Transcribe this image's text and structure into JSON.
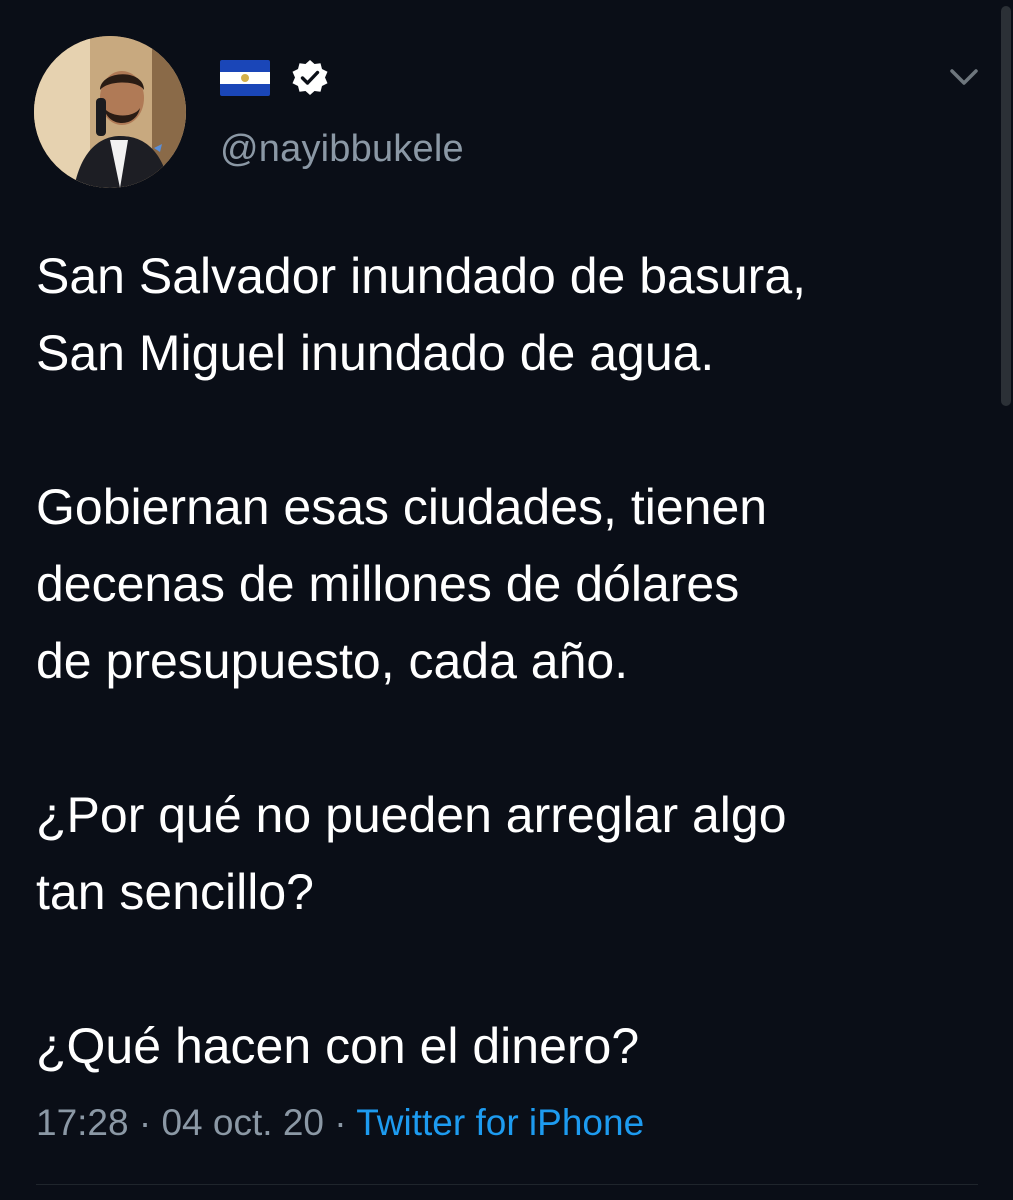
{
  "tweet": {
    "handle": "@nayibbukele",
    "paragraphs": [
      "San Salvador inundado de basura,\nSan Miguel inundado de agua.",
      "Gobiernan esas ciudades, tienen\ndecenas de millones de dólares\nde presupuesto, cada año.",
      "¿Por qué no pueden arreglar algo\ntan sencillo?",
      "¿Qué hacen con el dinero?"
    ],
    "time": "17:28",
    "separator": "·",
    "date": "04 oct. 20",
    "source": "Twitter for iPhone"
  },
  "colors": {
    "background": "#0a0e17",
    "text": "#ffffff",
    "muted": "#8b98a5",
    "link": "#1d9bf0"
  },
  "icons": {
    "flag": "el-salvador-flag-icon",
    "verified": "verified-badge-icon",
    "menu": "chevron-down-icon"
  }
}
